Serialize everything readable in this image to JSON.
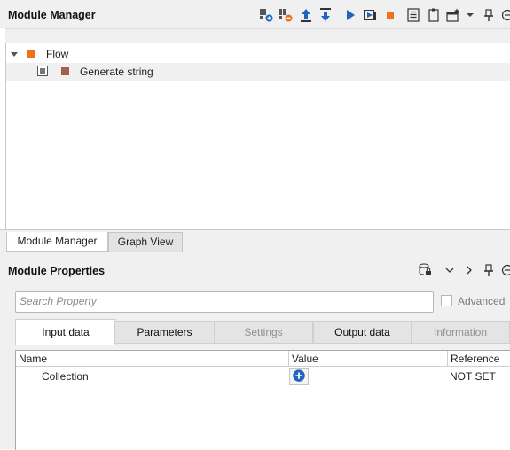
{
  "module_manager": {
    "title": "Module Manager",
    "toolbar_icons": [
      "add-module-icon",
      "remove-module-icon",
      "move-up-icon",
      "move-down-icon",
      "run-icon",
      "step-run-icon",
      "stop-icon",
      "list-icon",
      "clipboard-icon",
      "new-window-icon",
      "dropdown-arrow-icon",
      "pin-icon",
      "minimize-icon"
    ],
    "tree": [
      {
        "label": "Flow",
        "color": "#f07020",
        "expanded": true
      },
      {
        "label": "Generate string",
        "color": "#a5604c"
      }
    ],
    "tabs": [
      {
        "label": "Module Manager",
        "active": true
      },
      {
        "label": "Graph View",
        "active": false
      }
    ]
  },
  "module_properties": {
    "title": "Module Properties",
    "search_placeholder": "Search Property",
    "advanced_label": "Advanced",
    "tabs": [
      {
        "label": "Input data",
        "active": true,
        "enabled": true
      },
      {
        "label": "Parameters",
        "active": false,
        "enabled": true
      },
      {
        "label": "Settings",
        "active": false,
        "enabled": false
      },
      {
        "label": "Output data",
        "active": false,
        "enabled": true
      },
      {
        "label": "Information",
        "active": false,
        "enabled": false
      }
    ],
    "columns": [
      "Name",
      "Value",
      "Reference"
    ],
    "rows": [
      {
        "name": "Collection",
        "value_icon": "plus-circle-icon",
        "reference": "NOT SET"
      }
    ]
  },
  "colors": {
    "flow": "#f07020",
    "module": "#a5604c",
    "accent_blue": "#1f64c0",
    "stop": "#f07020"
  }
}
